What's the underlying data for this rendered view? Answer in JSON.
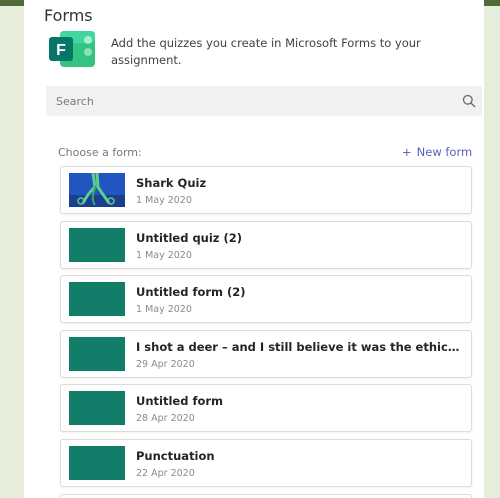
{
  "header": {
    "title": "Forms",
    "description": "Add the quizzes you create in Microsoft Forms to your assignment."
  },
  "search": {
    "placeholder": "Search"
  },
  "list_header": {
    "choose_label": "Choose a form:",
    "new_form_label": "New form"
  },
  "forms": [
    {
      "title": "Shark Quiz",
      "date": "1 May 2020",
      "thumbnail": "shark-image"
    },
    {
      "title": "Untitled quiz (2)",
      "date": "1 May 2020",
      "thumbnail": "teal-block"
    },
    {
      "title": "Untitled form (2)",
      "date": "1 May 2020",
      "thumbnail": "teal-block"
    },
    {
      "title": "I shot a deer – and I still believe it was the ethical thing...",
      "date": "29 Apr 2020",
      "thumbnail": "teal-block"
    },
    {
      "title": "Untitled form",
      "date": "28 Apr 2020",
      "thumbnail": "teal-block"
    },
    {
      "title": "Punctuation",
      "date": "22 Apr 2020",
      "thumbnail": "teal-block"
    }
  ],
  "colors": {
    "accent": "#5b5fc7",
    "thumbnail": "#127d69",
    "forms_brand": "#077568"
  },
  "icons": [
    "microsoft-forms-logo",
    "search-icon",
    "plus-icon"
  ]
}
